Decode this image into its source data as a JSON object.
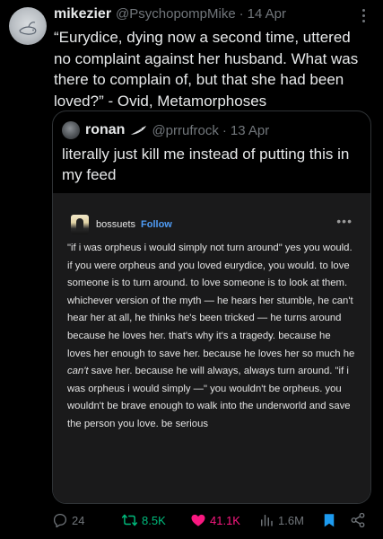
{
  "tweet": {
    "author_name": "mikezier",
    "author_handle": "@PsychopompMike",
    "separator": "·",
    "date": "14 Apr",
    "text": "“Eurydice, dying now a second time, uttered no complaint against her husband. What was there to complain of, but that she had been loved?” - Ovid, Metamorphoses"
  },
  "quote": {
    "author_name": "ronan",
    "author_handle": "@prrufrock",
    "separator": "·",
    "date": "13 Apr",
    "text": "literally just kill me instead of putting this in my feed"
  },
  "embedded_post": {
    "username": "bossuets",
    "follow_label": "Follow",
    "more": "•••",
    "body_1": "\"if i was orpheus i would simply not turn around\" yes you would. if you were orpheus and you loved eurydice, you would. to love someone is to turn around. to love someone is to look at them. whichever version of the myth — he hears her stumble, he can't hear her at all, he thinks he's been tricked — he turns around because he loves her. that's why it's a tragedy. because he loves her enough to save her. because he loves her so much he ",
    "body_em": "can't",
    "body_2": " save her. because he will always, always turn around. \"if i was orpheus i would simply —\" you wouldn't be orpheus. you wouldn't be brave enough to walk into the underworld and save the person you love. be serious"
  },
  "actions": {
    "replies": "24",
    "retweets": "8.5K",
    "likes": "41.1K",
    "views": "1.6M"
  },
  "colors": {
    "background": "#000000",
    "text": "#e7e9ea",
    "muted": "#71767b",
    "retweet_active": "#00ba7c",
    "like_active": "#f91880",
    "bookmark_active": "#1d9bf0",
    "follow_link": "#4f9cf5"
  },
  "icons": {
    "more": "more-horizontal-icon",
    "reply": "reply-icon",
    "retweet": "retweet-icon",
    "like": "heart-icon",
    "views": "views-icon",
    "bookmark": "bookmark-icon",
    "share": "share-icon",
    "feather": "feather-icon"
  }
}
